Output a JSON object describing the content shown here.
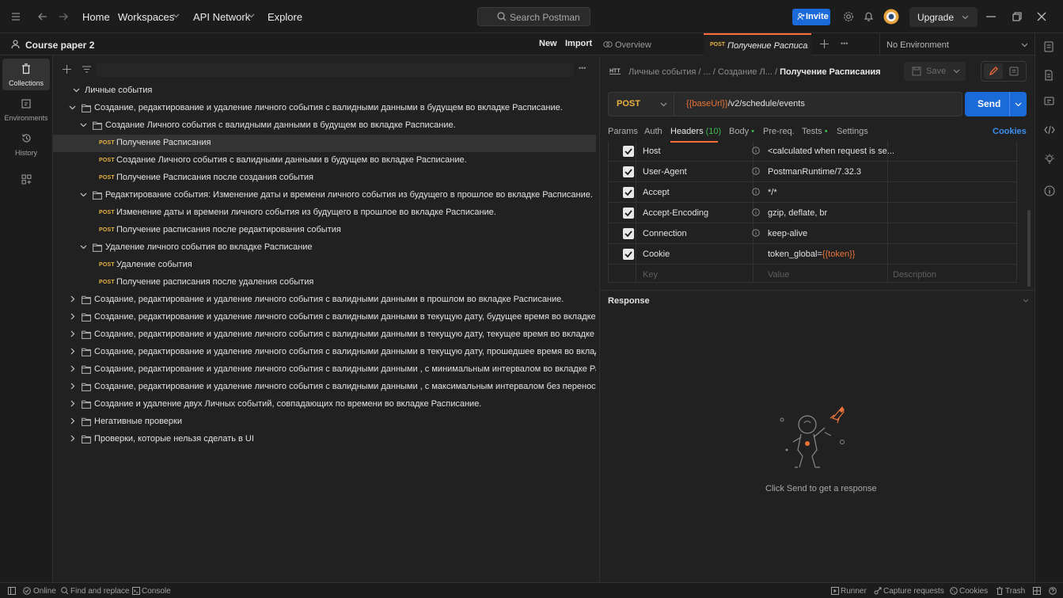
{
  "topbar": {
    "nav": [
      "Home",
      "Workspaces",
      "API Network",
      "Explore"
    ],
    "search_placeholder": "Search Postman",
    "invite_label": "Invite",
    "upgrade_label": "Upgrade"
  },
  "workspace": {
    "name": "Course paper 2",
    "new_label": "New",
    "import_label": "Import"
  },
  "tabs": {
    "overview": "Overview",
    "active_method": "POST",
    "active_title": "Получение Расписания",
    "more": "•••",
    "environment": "No Environment"
  },
  "sidebar": {
    "collections": "Collections",
    "environments": "Environments",
    "history": "History"
  },
  "tree": {
    "root": "Личные события",
    "rows": [
      {
        "type": "folder",
        "text": "Создание, редактирование и удаление личного события с валидными данными в будущем во вкладке Расписание."
      },
      {
        "type": "folder",
        "text": "Создание Личного события с валидными данными в будущем во вкладке Расписание."
      },
      {
        "type": "request",
        "method": "POST",
        "text": "Получение Расписания"
      },
      {
        "type": "request",
        "method": "POST",
        "text": "Создание Личного события с валидными данными в будущем во вкладке Расписание."
      },
      {
        "type": "request",
        "method": "POST",
        "text": "Получение Расписания после создания события"
      },
      {
        "type": "folder",
        "text": "Редактирование события: Изменение даты и времени личного события из будущего в прошлое во вкладке Расписание."
      },
      {
        "type": "request",
        "method": "POST",
        "text": "Изменение даты и времени личного события из будущего в прошлое во вкладке Расписание."
      },
      {
        "type": "request",
        "method": "POST",
        "text": "Получение расписания после редактирования события"
      },
      {
        "type": "folder",
        "text": "Удаление личного события во вкладке Расписание"
      },
      {
        "type": "request",
        "method": "POST",
        "text": "Удаление события"
      },
      {
        "type": "request",
        "method": "POST",
        "text": "Получение расписания после удаления события"
      },
      {
        "type": "folder",
        "text": "Создание, редактирование и удаление личного события с валидными данными в прошлом во вкладке Расписание."
      },
      {
        "type": "folder",
        "text": "Создание, редактирование и удаление личного события с валидными данными в текущую дату, будущее время во вкладке Р..."
      },
      {
        "type": "folder",
        "text": "Создание, редактирование и удаление личного события с валидными данными в текущую дату, текущее время во вкладке Ра..."
      },
      {
        "type": "folder",
        "text": "Создание, редактирование и удаление личного события с валидными данными в текущую дату, прошедшее время во вкладк..."
      },
      {
        "type": "folder",
        "text": "Создание, редактирование и удаление личного события с валидными данными , с минимальным интервалом во вкладке Расп..."
      },
      {
        "type": "folder",
        "text": "Создание, редактирование и удаление личного события с валидными данными , с максимальным интервалом без переноса п..."
      },
      {
        "type": "folder",
        "text": "Создание и удаление двух Личных событий, совпадающих по времени во вкладке Расписание."
      },
      {
        "type": "folder",
        "text": "Негативные проверки"
      },
      {
        "type": "folder",
        "text": "Проверки, которые нельзя сделать в UI"
      }
    ]
  },
  "request": {
    "breadcrumb_1": "Личные события",
    "breadcrumb_sep": "/",
    "breadcrumb_2": "...",
    "breadcrumb_3": "Создание Л...",
    "title": "Получение Расписания",
    "save_label": "Save",
    "method": "POST",
    "url_var": "{{baseUrl}}",
    "url_path": "/v2/schedule/events",
    "send_label": "Send",
    "params_tabs": {
      "params": "Params",
      "auth": "Auth",
      "headers": "Headers",
      "headers_count": "(10)",
      "body": "Body",
      "prereq": "Pre-req.",
      "tests": "Tests",
      "settings": "Settings",
      "cookies": "Cookies"
    },
    "headers": [
      {
        "key": "Host",
        "value": "<calculated when request is se..."
      },
      {
        "key": "User-Agent",
        "value": "PostmanRuntime/7.32.3"
      },
      {
        "key": "Accept",
        "value": "*/*"
      },
      {
        "key": "Accept-Encoding",
        "value": "gzip, deflate, br"
      },
      {
        "key": "Connection",
        "value": "keep-alive"
      },
      {
        "key": "Cookie",
        "value": "token_global=",
        "value_var": "{{token}}"
      }
    ],
    "placeholders": {
      "key": "Key",
      "value": "Value",
      "description": "Description"
    }
  },
  "response": {
    "title": "Response",
    "empty_text": "Click Send to get a response"
  },
  "status": {
    "online": "Online",
    "find_replace": "Find and replace",
    "console": "Console",
    "runner": "Runner",
    "capture": "Capture requests",
    "cookies": "Cookies",
    "trash": "Trash"
  },
  "colors": {
    "accent": "#1a6ad9",
    "post_method": "#e8b341",
    "variable": "#e8733a",
    "active_tab": "#ff6c37",
    "green_dot": "#3fb950"
  }
}
